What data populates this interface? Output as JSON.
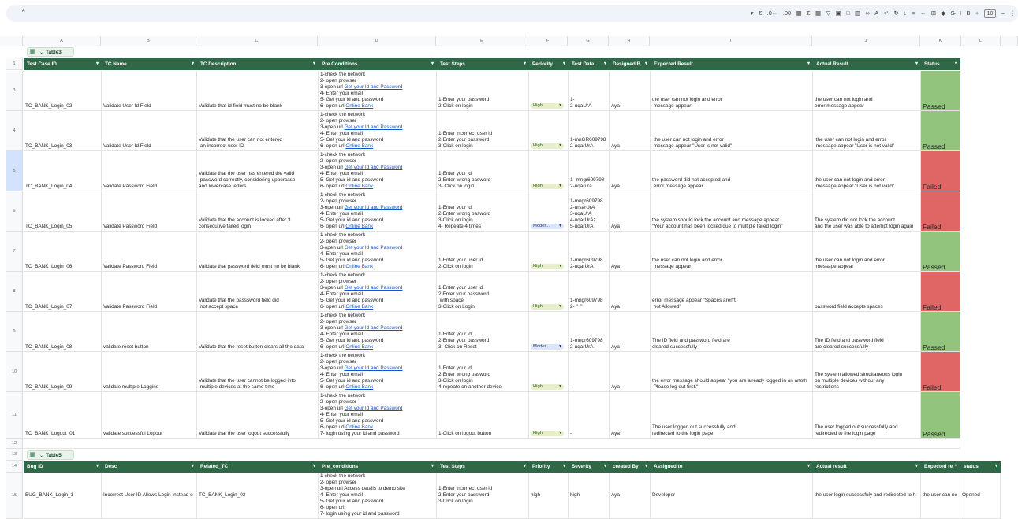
{
  "toolbar": {
    "font_size": "10",
    "icons": [
      "chevron-down-icon",
      "currency-icon",
      "decimal-decrease-icon",
      "decimal-increase-icon",
      "table-icon",
      "sum-icon",
      "table-icon",
      "filter-icon",
      "image-icon",
      "comment-icon",
      "chart-icon",
      "link-icon",
      "text-color-icon",
      "text-wrap-icon",
      "text-rotate-icon",
      "valign-icon",
      "halign-icon",
      "merge-icon",
      "borders-icon",
      "fill-color-icon",
      "strikethrough-icon",
      "italic-icon",
      "bold-icon",
      "plus-icon",
      "minus-icon",
      "more-icon"
    ]
  },
  "column_letters": [
    "A",
    "B",
    "C",
    "D",
    "E",
    "F",
    "G",
    "H",
    "I",
    "J",
    "K",
    "L"
  ],
  "row_numbers": [
    "1",
    "3",
    "4",
    "5",
    "6",
    "7",
    "8",
    "9",
    "10",
    "11",
    "12",
    "13",
    "14",
    "15"
  ],
  "table3": {
    "name": "Table3",
    "headers": [
      "Test Case ID",
      "TC Name",
      "TC Description",
      "Pre Conditions",
      "Test Steps",
      "Periority",
      "Test Data",
      "Designed B",
      "Expected Result",
      "Actual Result",
      "Status"
    ],
    "rows": [
      {
        "id": "TC_BANK_Login_02",
        "name": "Validate User Id Field",
        "desc": "Validate that id field must no be blank",
        "pre": [
          "1-check the network",
          "2- open prowser",
          "3-open url ",
          "4- Enter your email",
          "5- Get your id and password",
          "6- open url "
        ],
        "steps": "1-Enter your password\n2-Click on login",
        "priority": "High",
        "data": "1-\n2-uqaUrA",
        "designed": "Aya",
        "expected": "the user can not login and error\n message appear",
        "actual": "the user can not login and\nerror message appear",
        "status": "Passed"
      },
      {
        "id": "TC_BANK_Login_03",
        "name": "Validate User Id Field",
        "desc": "Validate that the user can not entered\n an incorrect user ID",
        "pre": [
          "1-check the network",
          "2- open prowser",
          "3-open url ",
          "4- Enter your email",
          "5- Get your id and password",
          "6- open url "
        ],
        "steps": "1-Enter incorrect user id\n2-Enter your password\n3-Click on login",
        "priority": "High",
        "data": "1-mnGR609798\n2-uqarUrA",
        "designed": "Aya",
        "expected": " the user can not login and error\n message appear \"User is not valid\"",
        "actual": " the user can not login and error\n message appear \"User is not valid\"",
        "status": "Passed"
      },
      {
        "id": "TC_BANK_Login_04",
        "name": "Validate Password Field",
        "desc": "Validate that the user has entered the valid\n password correctly, considering uppercase\nand lowercase letters",
        "pre": [
          "1-check the network",
          "2- open prowser",
          "3-open url ",
          "4- Enter your email",
          "5- Get your id and password",
          "6- open url "
        ],
        "steps": "1-Enter your id\n2-Enter wrong pasword\n3- Click on login",
        "priority": "High",
        "data": "1- mngr609798\n2-uqarura",
        "designed": "Aya",
        "expected": "the password did not accepted and\n error message appear",
        "actual": "the user can not login and error\n message appear \"User is not valid\"",
        "status": "Failed"
      },
      {
        "id": "TC_BANK_Login_05",
        "name": "Validate Password Field",
        "desc": "Validate that the account is locked after 3\nconsecutive failed login",
        "pre": [
          "1-check the network",
          "2- open prowser",
          "3-open url ",
          "4- Enter your email",
          "5- Get your id and password",
          "6- open url "
        ],
        "steps": "1-Enter your id\n2-Enter wrong pasword\n3-Click on login\n4- Repeate 4 times",
        "priority": "Moder...",
        "data": "1-mngr609798\n2-ursarUrA\n3-uqaUrA\n4-uqarUrAz\n5-uqarUrA",
        "designed": "Aya",
        "expected": "the system should lock the account and message appear\n\"Your account has been locked due to multiple failed login\"",
        "actual": "The system did not lock the account\nand the user was able to attempt login again",
        "status": "Failed"
      },
      {
        "id": "TC_BANK_Login_06",
        "name": "Validate Password Field",
        "desc": "Validate that password field must no be blank",
        "pre": [
          "1-check the network",
          "2- open prowser",
          "3-open url ",
          "4- Enter your email",
          "5- Get your id and password",
          "6- open url "
        ],
        "steps": "1-Enter your user id\n2-Click on login",
        "priority": "High",
        "data": "1-mngr609798\n2-uqarUrA",
        "designed": "Aya",
        "expected": "the user can not login and error\n message appear",
        "actual": "the user can not login and error\n message appear",
        "status": "Passed"
      },
      {
        "id": "TC_BANK_Login_07",
        "name": "Validate Password Field",
        "desc": "Validate that the passsword field did\n not accept space",
        "pre": [
          "1-check the network",
          "2- open prowser",
          "3-open url ",
          "4- Enter your email",
          "5- Get your id and password",
          "6- open url "
        ],
        "steps": "1-Enter your user id\n2 Enter your password\n with space\n3-Click on Login",
        "priority": "High",
        "data": "1-mngr609798\n2- \"  \"",
        "designed": "Aya",
        "expected": "error message appear \"Spaces aren't\n not Allowed\"",
        "actual": "password field accepts spaces",
        "status": "Failed"
      },
      {
        "id": "TC_BANK_Login_08",
        "name": "validate reset button",
        "desc": "Validate that the reset button clears all the data",
        "pre": [
          "1-check the network",
          "2- open prowser",
          "3-open url ",
          "4- Enter your email",
          "5- Get your id and password",
          "6- open url "
        ],
        "steps": "1-Enter your id\n2-Enter your password\n3- Click on Reset",
        "priority": "Moder...",
        "data": "1-mngr609798\n2-uqarUrA",
        "designed": "Aya",
        "expected": "The ID field and password field are\ncleared successfully",
        "actual": "The ID field and password field\nare cleared successfully",
        "status": "Passed"
      },
      {
        "id": "TC_BANK_Login_09",
        "name": "validate multiple Loggins",
        "desc": "Validate that the user cannot be logged into\n multiple devices at the same time",
        "pre": [
          "1-check the network",
          "2- open prowser",
          "3-open url ",
          "4- Enter your email",
          "5- Get your id and password",
          "6- open url "
        ],
        "steps": "1-Enter your id\n2-Enter wrong pasword\n3-Click on login\n4-repeate on another device",
        "priority": "High",
        "data": "-",
        "designed": "Aya",
        "expected": "the error message should appear \"you are already logged in on anoth\n Please log out first.\"",
        "actual": "The system allowed simultaneous login\non multiple devices without any\nrestrictions",
        "status": "Failed"
      },
      {
        "id": "TC_BANK_Logout_01",
        "name": "validate successful Logout",
        "desc": "Validate that the user logout successfully",
        "pre": [
          "1-check the network",
          "2- open prowser",
          "3-open url ",
          "4- Enter your email",
          "5- Get your id and password",
          "6- open url ",
          "7- login using your id and password"
        ],
        "steps": "1-Click on logout button",
        "priority": "High",
        "data": "-",
        "designed": "Aya",
        "expected": "The user logged out successfully and\nredirected to the login page",
        "actual": "The user logged out successfully and\nredirected to the login page",
        "status": "Passed"
      }
    ],
    "link_id": "Get your Id and Password",
    "link_bank": "Online Bank"
  },
  "table5": {
    "name": "Table5",
    "headers": [
      "Bug ID",
      "Desc",
      "Related_TC",
      "Pre_conditions",
      "Test Steps",
      "Priority",
      "Severity",
      "created By",
      "Assigned to",
      "Actual result",
      "Expected re",
      "status"
    ],
    "row": {
      "id": "BUG_BANK_Login_1",
      "desc": "Incorrect User ID Allows Login Instead o",
      "related": "TC_BANK_Login_03",
      "pre": "1-check the network\n2- open prowser\n3-open url Access details to demo site\n4- Enter your email\n5- Get your id and password\n6- open url\n7- login using your id and password",
      "steps": "1-Enter incorrect user id\n2-Enter your password\n3-Click on login",
      "priority": "high",
      "severity": "high",
      "created": "Aya",
      "assigned": "Developer",
      "actual": "the user login successfuly and redirected to h",
      "expected": "the user can no",
      "status": "Opened"
    }
  },
  "colors": {
    "header_green": "#2e6847",
    "passed": "#93c47d",
    "failed": "#e06666"
  }
}
